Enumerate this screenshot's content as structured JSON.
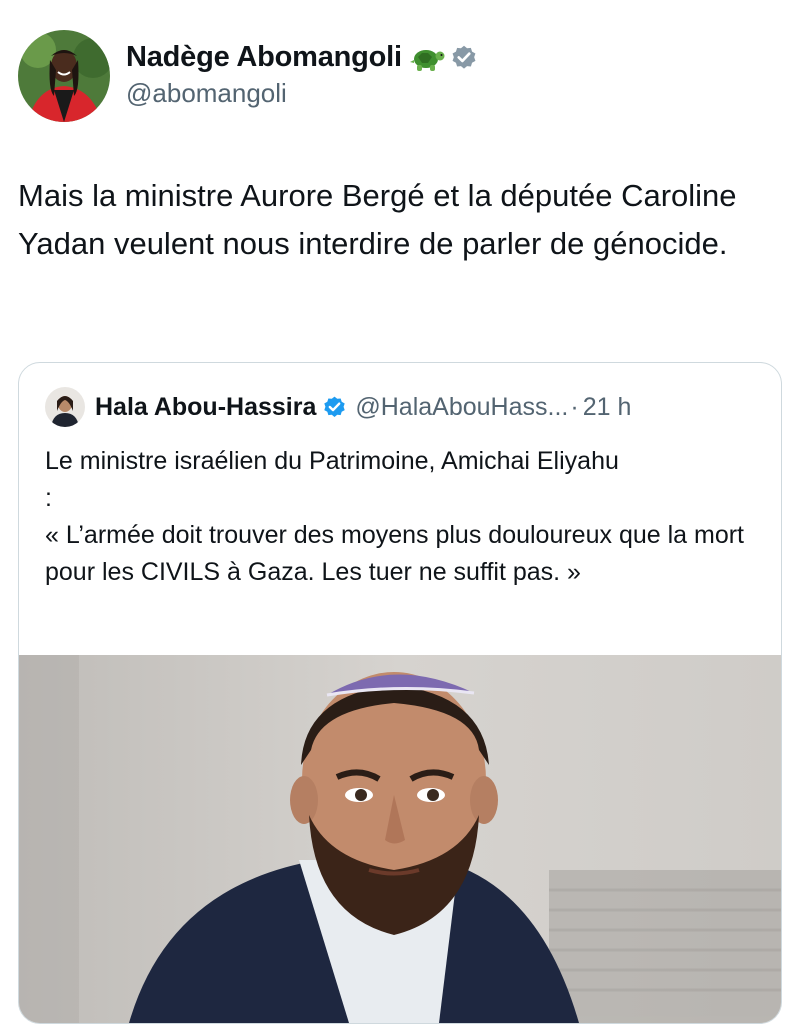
{
  "author": {
    "name": "Nadège Abomangoli",
    "handle": "@abomangoli",
    "emoji_icon": "turtle-icon",
    "verified_icon": "verified-badge-icon"
  },
  "tweet": {
    "text": "Mais la ministre Aurore Bergé et la députée Caroline Yadan veulent nous interdire de parler de génocide."
  },
  "quote": {
    "name": "Hala Abou-Hassira",
    "handle": "@HalaAbouHass...",
    "separator": "·",
    "time": "21 h",
    "line1": "Le ministre israélien du Patrimoine, Amichai Eliyahu",
    "line2": ":",
    "line3": "« L’armée doit trouver des moyens plus douloureux que la mort pour les CIVILS à Gaza. Les tuer ne suffit pas. »"
  },
  "colors": {
    "text": "#0f1419",
    "secondary": "#536471",
    "verified": "#1d9bf0",
    "border": "#cfd9de"
  }
}
